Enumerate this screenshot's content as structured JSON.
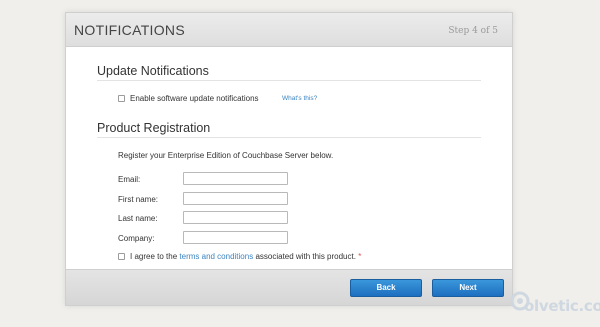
{
  "header": {
    "title": "NOTIFICATIONS",
    "step": "Step 4 of 5"
  },
  "update_notifications": {
    "title": "Update Notifications",
    "checkbox_label": "Enable software update notifications",
    "whats_this": "What's this?"
  },
  "product_registration": {
    "title": "Product Registration",
    "intro": "Register your Enterprise Edition of Couchbase Server below.",
    "fields": {
      "email": {
        "label": "Email:",
        "value": ""
      },
      "first_name": {
        "label": "First name:",
        "value": ""
      },
      "last_name": {
        "label": "Last name:",
        "value": ""
      },
      "company": {
        "label": "Company:",
        "value": ""
      }
    },
    "terms": {
      "prefix": "I agree to the",
      "link": "terms and conditions",
      "suffix": "associated with this product.",
      "required_mark": "*"
    }
  },
  "footer": {
    "back_label": "Back",
    "next_label": "Next"
  },
  "watermark": {
    "text": "olvetic.com"
  },
  "colors": {
    "link": "#3c84c2",
    "button": "#2a84cf",
    "required": "#d9534f"
  }
}
